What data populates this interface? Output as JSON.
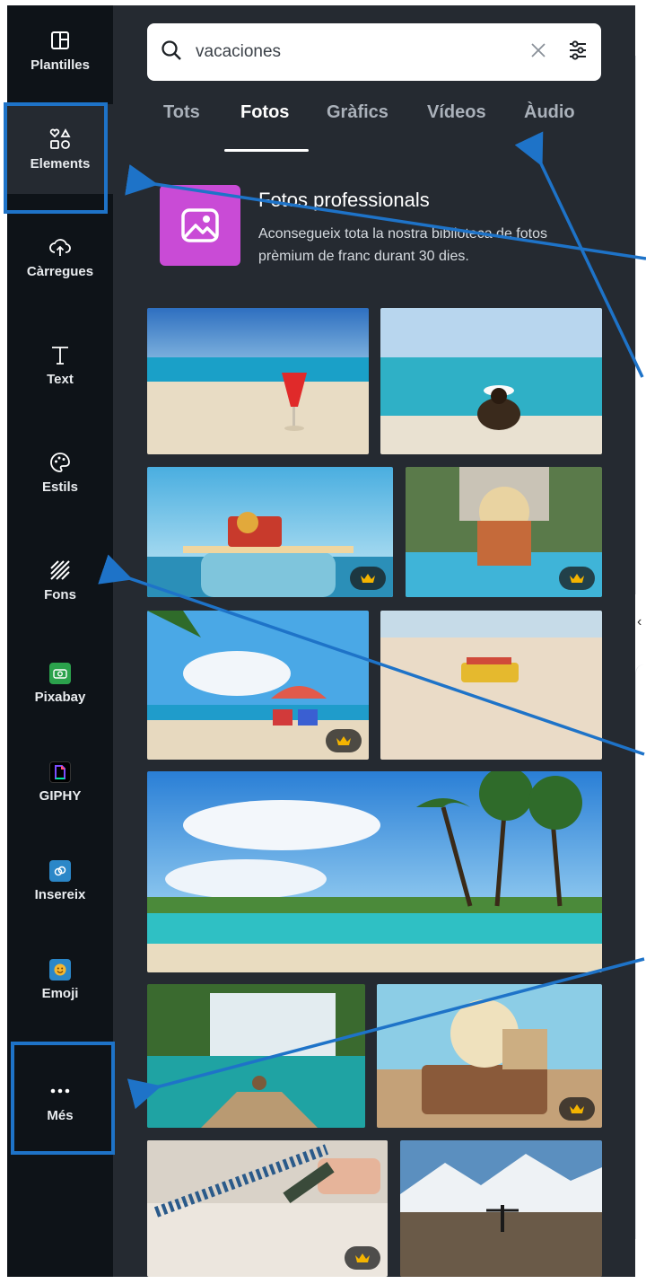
{
  "sidebar": {
    "items": [
      {
        "label": "Plantilles",
        "icon": "layout-icon"
      },
      {
        "label": "Elements",
        "icon": "shapes-icon"
      },
      {
        "label": "Càrregues",
        "icon": "cloud-upload-icon"
      },
      {
        "label": "Text",
        "icon": "text-icon"
      },
      {
        "label": "Estils",
        "icon": "palette-icon"
      },
      {
        "label": "Fons",
        "icon": "stripes-icon"
      },
      {
        "label": "Pixabay",
        "icon": "pixabay-icon"
      },
      {
        "label": "GIPHY",
        "icon": "giphy-icon"
      },
      {
        "label": "Insereix",
        "icon": "embed-icon"
      },
      {
        "label": "Emoji",
        "icon": "emoji-icon"
      },
      {
        "label": "Més",
        "icon": "more-icon"
      }
    ]
  },
  "search": {
    "value": "vacaciones"
  },
  "tabs": [
    {
      "label": "Tots"
    },
    {
      "label": "Fotos",
      "active": true
    },
    {
      "label": "Gràfics"
    },
    {
      "label": "Vídeos"
    },
    {
      "label": "Àudio"
    }
  ],
  "promo": {
    "title": "Fotos professionals",
    "description": "Aconsegueix tota la nostra biblioteca de fotos prèmium de franc durant 30 dies."
  },
  "photos": [
    {
      "subject": "cocktail on beach"
    },
    {
      "subject": "woman with hat on beach",
      "premium": false
    },
    {
      "subject": "car with luggage on roof",
      "premium": true
    },
    {
      "subject": "woman in deck chair by pool",
      "premium": true
    },
    {
      "subject": "palm trees and beach umbrella",
      "premium": true
    },
    {
      "subject": "toy van on sand"
    },
    {
      "subject": "tropical beach with palms"
    },
    {
      "subject": "woman on boat in lagoon"
    },
    {
      "subject": "suitcase with beach items",
      "premium": true
    },
    {
      "subject": "calendar marked holiday",
      "premium": true
    },
    {
      "subject": "man on mountain top"
    }
  ],
  "colors": {
    "rail": "#0e1318",
    "panel": "#252a31",
    "highlight": "#1e73c8",
    "premium_crown": "#f4b400"
  }
}
